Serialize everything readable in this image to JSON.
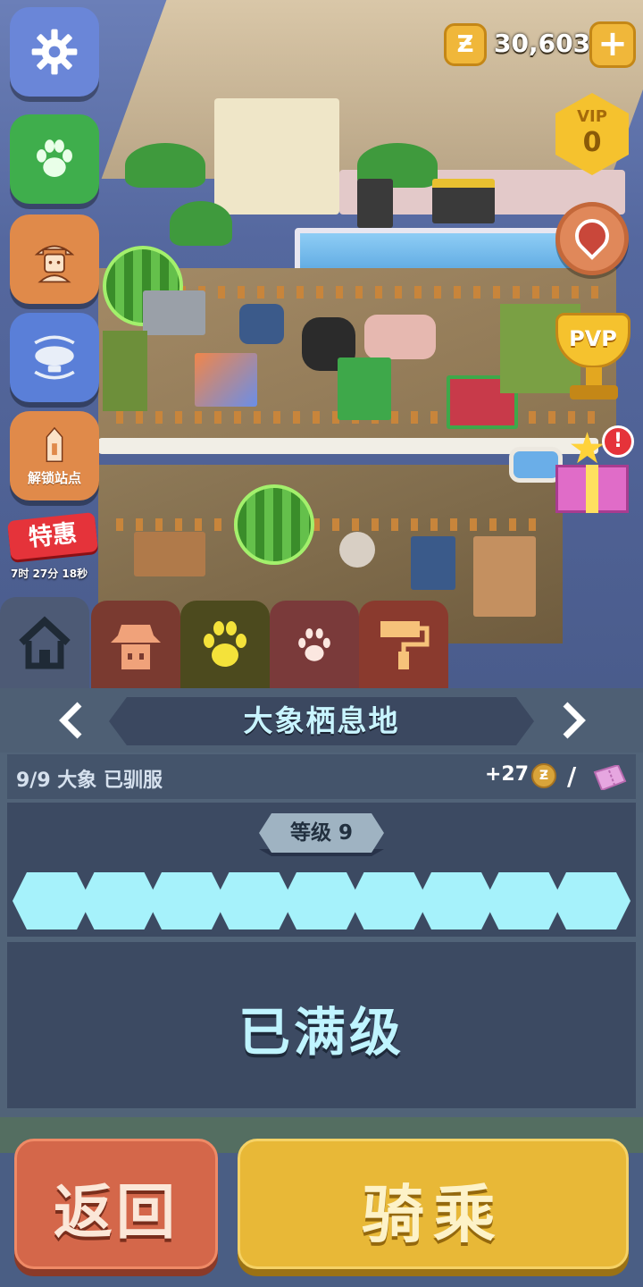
{
  "hud": {
    "currency_icon": "Ƶ",
    "currency_amount": "30,603",
    "add_label": "+",
    "vip_label": "VIP",
    "vip_level": "0",
    "pvp_label": "PVP",
    "gift_alert": "!"
  },
  "sidebar": {
    "unlock_label": "解锁站点",
    "promo_label": "特惠",
    "promo_timer": "7时 27分 18秒"
  },
  "panel": {
    "habitat_name": "大象栖息地",
    "tamed_status": "9/9 大象 已驯服",
    "income": "+27",
    "income_coin": "Ƶ",
    "slash": "/",
    "level_label": "等级 9",
    "level_filled": 9,
    "level_total": 9,
    "max_label": "已满级"
  },
  "footer": {
    "back_label": "返回",
    "ride_label": "骑乘"
  },
  "colors": {
    "progress_fill": "#a6f2fb",
    "panel_bg": "#516378",
    "back_button": "#d4674a",
    "ride_button": "#e8b837"
  },
  "icons": {
    "settings": "gear-icon",
    "animals": "paw-icon",
    "keeper": "zookeeper-icon",
    "transfer": "airship-icon",
    "unlock": "unlock-station-icon",
    "home": "home-icon",
    "decor": "paint-roller-icon",
    "ticket": "ticket-icon"
  }
}
